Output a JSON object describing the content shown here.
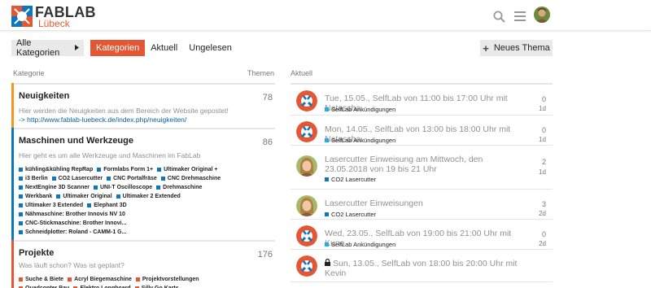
{
  "header": {
    "logo_main": "FABLAB",
    "logo_sub": "Lübeck",
    "icons": [
      "search-icon",
      "hamburger-menu-icon",
      "user-avatar"
    ]
  },
  "nav": {
    "category_dropdown": "Alle Kategorien",
    "tabs": [
      "Kategorien",
      "Aktuell",
      "Ungelesen"
    ],
    "active_tab": "Kategorien",
    "new_topic": "Neues Thema"
  },
  "columns": {
    "category": "Kategorie",
    "topics": "Themen",
    "latest": "Aktuell"
  },
  "colors": {
    "accent": "#e45735",
    "orange": "#f7941d",
    "blue": "#0e76bd",
    "red": "#e45735",
    "navy": "#0e76bd",
    "selflab": "#25aae1"
  },
  "categories": [
    {
      "title": "Neuigkeiten",
      "count": "78",
      "desc": "Hier werden die Neuigkeiten aus dem Bereich der Website gepostet!",
      "link": "-> http://www.fablab-luebeck.de/index.php/neuigkeiten/",
      "color": "#f7941d",
      "subcats": []
    },
    {
      "title": "Maschinen und Werkzeuge",
      "count": "86",
      "desc": "Hier geht es um alle Werkzeuge und Maschinen im FabLab",
      "link": "",
      "color": "#0e76bd",
      "subcats": [
        "kühling&kühling RepRap",
        "Formlabs Form 1+",
        "Ultimaker Original +",
        "i3 Berlin",
        "CO2 Lasercutter",
        "CNC Portalfräse",
        "CNC Drehmaschine",
        "NextEngine 3D Scanner",
        "UNI-T Oscilloscope",
        "Drehmaschine",
        "Werkbank",
        "Ultimaker Original",
        "Ultimaker 2 Extended",
        "Ultimaker 3 Extended",
        "Elephant 3D",
        "Nähmaschine: Brother Innovis NV 10",
        "CNC-Stickmaschine: Brother Innovi...",
        "Schneidplotter: Roland - CAMM-1 G..."
      ]
    },
    {
      "title": "Projekte",
      "count": "176",
      "desc": "Was läuft schon? Was ist geplant?",
      "link": "",
      "color": "#e45735",
      "subcats": [
        "Suche & Biete",
        "Acryl Biegemaschine",
        "Projektvorstellungen",
        "Quadcopter Bau",
        "Elektro Longboard",
        "Silly Go Karts"
      ]
    }
  ],
  "topics": [
    {
      "title": "Tue, 15.05., SelfLab von 11:00 bis 17:00 Uhr mit Natascha",
      "category": "SelfLab Ankündigungen",
      "cat_color": "#25aae1",
      "replies": "0",
      "age": "1d",
      "avatar": "logo",
      "locked": false
    },
    {
      "title": "Mon, 14.05., SelfLab von 13:00 bis 18:00 Uhr mit Natascha",
      "category": "SelfLab Ankündigungen",
      "cat_color": "#25aae1",
      "replies": "0",
      "age": "1d",
      "avatar": "logo",
      "locked": false
    },
    {
      "title": "Lasercutter Einweisung am Mittwoch, den 23.05.2018 von 19 bis 21 Uhr",
      "category": "CO2 Lasercutter",
      "cat_color": "#0e76bd",
      "replies": "2",
      "age": "1d",
      "avatar": "person",
      "locked": false
    },
    {
      "title": "Lasercutter Einweisungen",
      "category": "CO2 Lasercutter",
      "cat_color": "#0e76bd",
      "replies": "3",
      "age": "2d",
      "avatar": "person",
      "locked": false
    },
    {
      "title": "Wed, 23.05., SelfLab von 19:00 bis 21:00 Uhr mit Kuno",
      "category": "SelfLab Ankündigungen",
      "cat_color": "#25aae1",
      "replies": "0",
      "age": "2d",
      "avatar": "logo",
      "locked": false
    },
    {
      "title": "Sun, 13.05., SelfLab von 18:00 bis 20:00 Uhr mit Kevin",
      "category": "",
      "cat_color": "#25aae1",
      "replies": "",
      "age": "",
      "avatar": "logo",
      "locked": true
    }
  ]
}
